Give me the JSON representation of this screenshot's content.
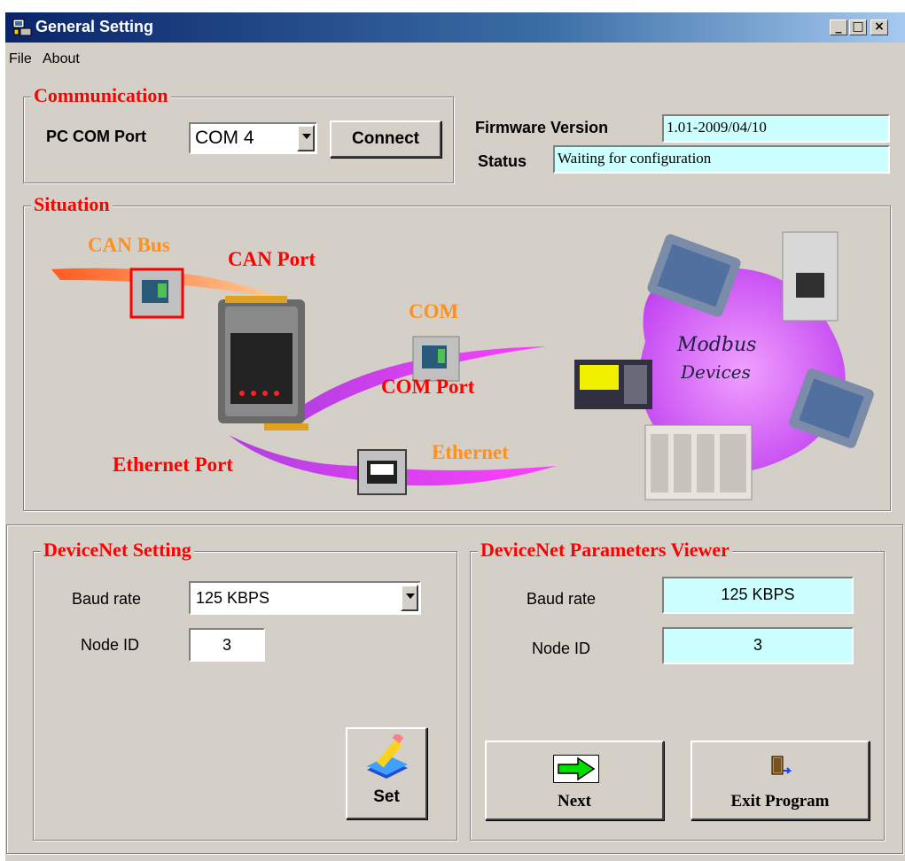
{
  "window": {
    "title": "General Setting"
  },
  "menu": {
    "file": "File",
    "about": "About"
  },
  "communication": {
    "title": "Communication",
    "port_label": "PC COM Port",
    "port_value": "COM 4",
    "connect_label": "Connect"
  },
  "info": {
    "firmware_label": "Firmware Version",
    "firmware_value": "1.01-2009/04/10",
    "status_label": "Status",
    "status_value": "Waiting for configuration"
  },
  "situation": {
    "title": "Situation",
    "can_bus": "CAN Bus",
    "can_port": "CAN Port",
    "com": "COM",
    "com_port": "COM Port",
    "ethernet": "Ethernet",
    "ethernet_port": "Ethernet Port",
    "modbus_line1": "Modbus",
    "modbus_line2": "Devices"
  },
  "devicenet_setting": {
    "title": "DeviceNet  Setting",
    "baud_label": "Baud rate",
    "baud_value": "125 KBPS",
    "node_label": "Node ID",
    "node_value": "3",
    "set_label": "Set"
  },
  "viewer": {
    "title": "DeviceNet Parameters Viewer",
    "baud_label": "Baud rate",
    "baud_value": "125 KBPS",
    "node_label": "Node ID",
    "node_value": "3",
    "next_label": "Next",
    "exit_label": "Exit Program"
  }
}
